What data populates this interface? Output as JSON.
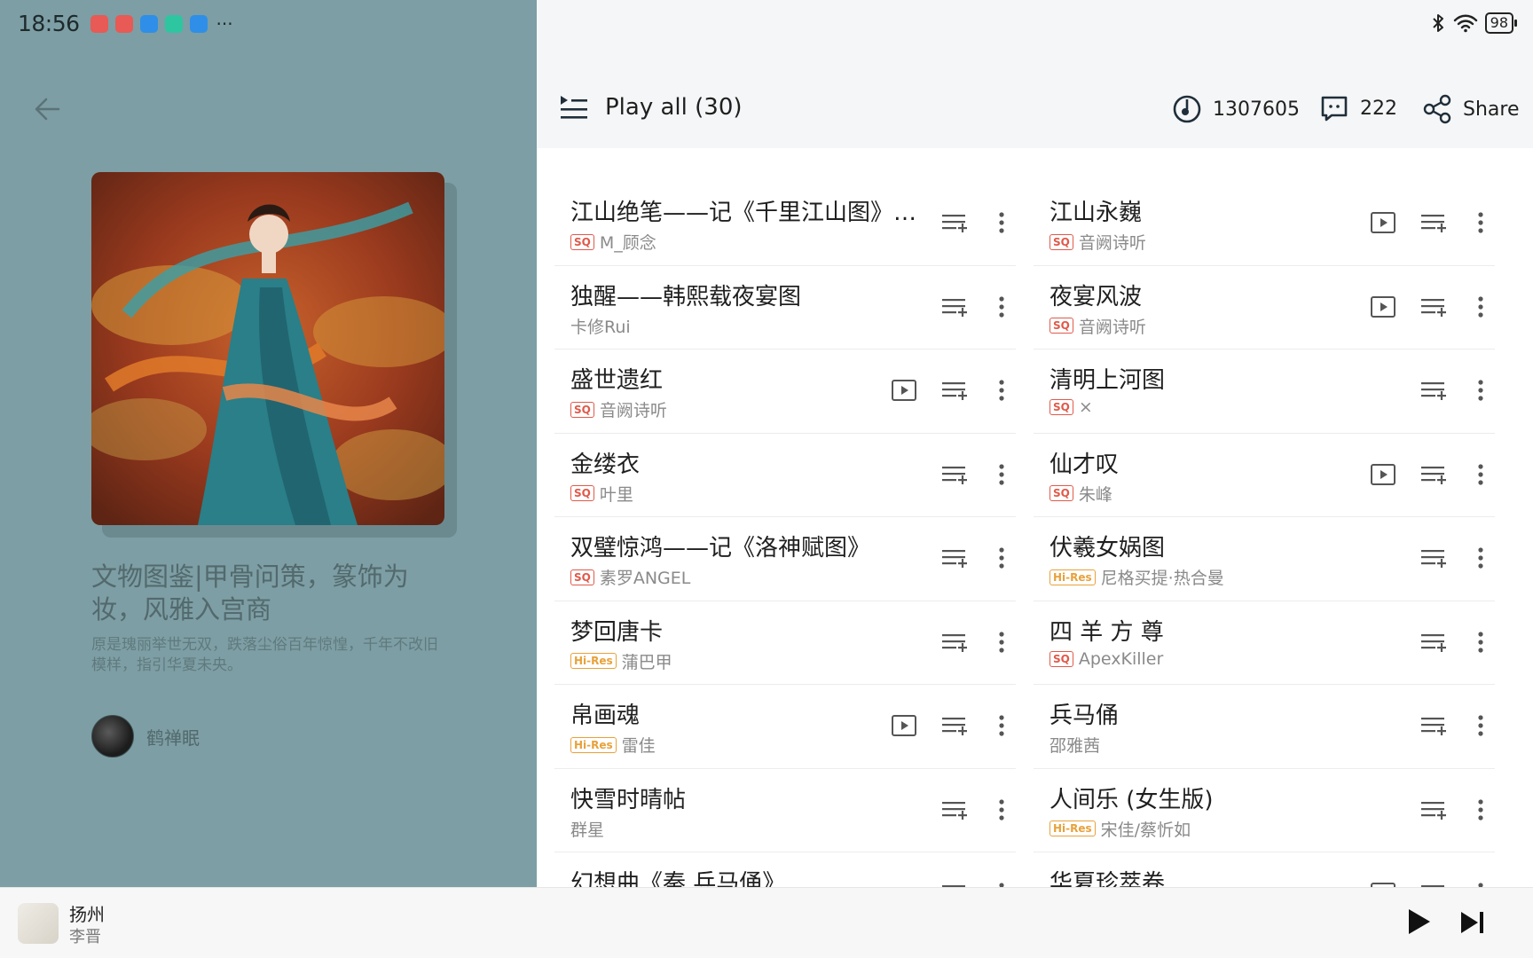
{
  "status": {
    "time": "18:56",
    "more": "···",
    "battery": "98"
  },
  "playlist": {
    "title": "文物图鉴|甲骨问策，篆饰为妆，风雅入宫商",
    "description": "原是瑰丽举世无双，跌落尘俗百年惊惶，千年不改旧模样，指引华夏未央。",
    "creator": "鹤禅眠"
  },
  "header": {
    "play_all": "Play all (30)",
    "play_count": "1307605",
    "comments": "222",
    "share": "Share"
  },
  "songs_left": [
    {
      "title": "江山绝笔——记《千里江山图》…",
      "badge": "SQ",
      "artist": "M_顾念",
      "video": false
    },
    {
      "title": "独醒——韩熙载夜宴图",
      "badge": "",
      "artist": "卡修Rui",
      "video": false
    },
    {
      "title": "盛世遗红",
      "badge": "SQ",
      "artist": "音阙诗听",
      "video": true
    },
    {
      "title": "金缕衣",
      "badge": "SQ",
      "artist": "叶里",
      "video": false
    },
    {
      "title": "双璧惊鸿——记《洛神赋图》",
      "badge": "SQ",
      "artist": "素罗ANGEL",
      "video": false
    },
    {
      "title": "梦回唐卡",
      "badge": "Hi-Res",
      "artist": "蒲巴甲",
      "video": false
    },
    {
      "title": "帛画魂",
      "badge": "Hi-Res",
      "artist": "雷佳",
      "video": true
    },
    {
      "title": "快雪时晴帖",
      "badge": "",
      "artist": "群星",
      "video": false
    },
    {
      "title": "幻想曲《秦.兵马俑》",
      "badge": "",
      "artist": "",
      "video": false
    }
  ],
  "songs_right": [
    {
      "title": "江山永巍",
      "badge": "SQ",
      "artist": "音阙诗听",
      "video": true
    },
    {
      "title": "夜宴风波",
      "badge": "SQ",
      "artist": "音阙诗听",
      "video": true
    },
    {
      "title": "清明上河图",
      "badge": "SQ",
      "artist": "×",
      "video": false
    },
    {
      "title": "仙才叹",
      "badge": "SQ",
      "artist": "朱峰",
      "video": true
    },
    {
      "title": "伏羲女娲图",
      "badge": "Hi-Res",
      "artist": "尼格买提·热合曼",
      "video": false
    },
    {
      "title": "四 羊 方 尊",
      "badge": "SQ",
      "artist": "ApexKiller",
      "video": false
    },
    {
      "title": "兵马俑",
      "badge": "",
      "artist": "邵雅茜",
      "video": false
    },
    {
      "title": "人间乐 (女生版)",
      "badge": "Hi-Res",
      "artist": "宋佳/蔡忻如",
      "video": false
    },
    {
      "title": "华夏珍萃卷",
      "badge": "",
      "artist": "",
      "video": true
    }
  ],
  "now_playing": {
    "title": "扬州",
    "artist": "李晋"
  }
}
